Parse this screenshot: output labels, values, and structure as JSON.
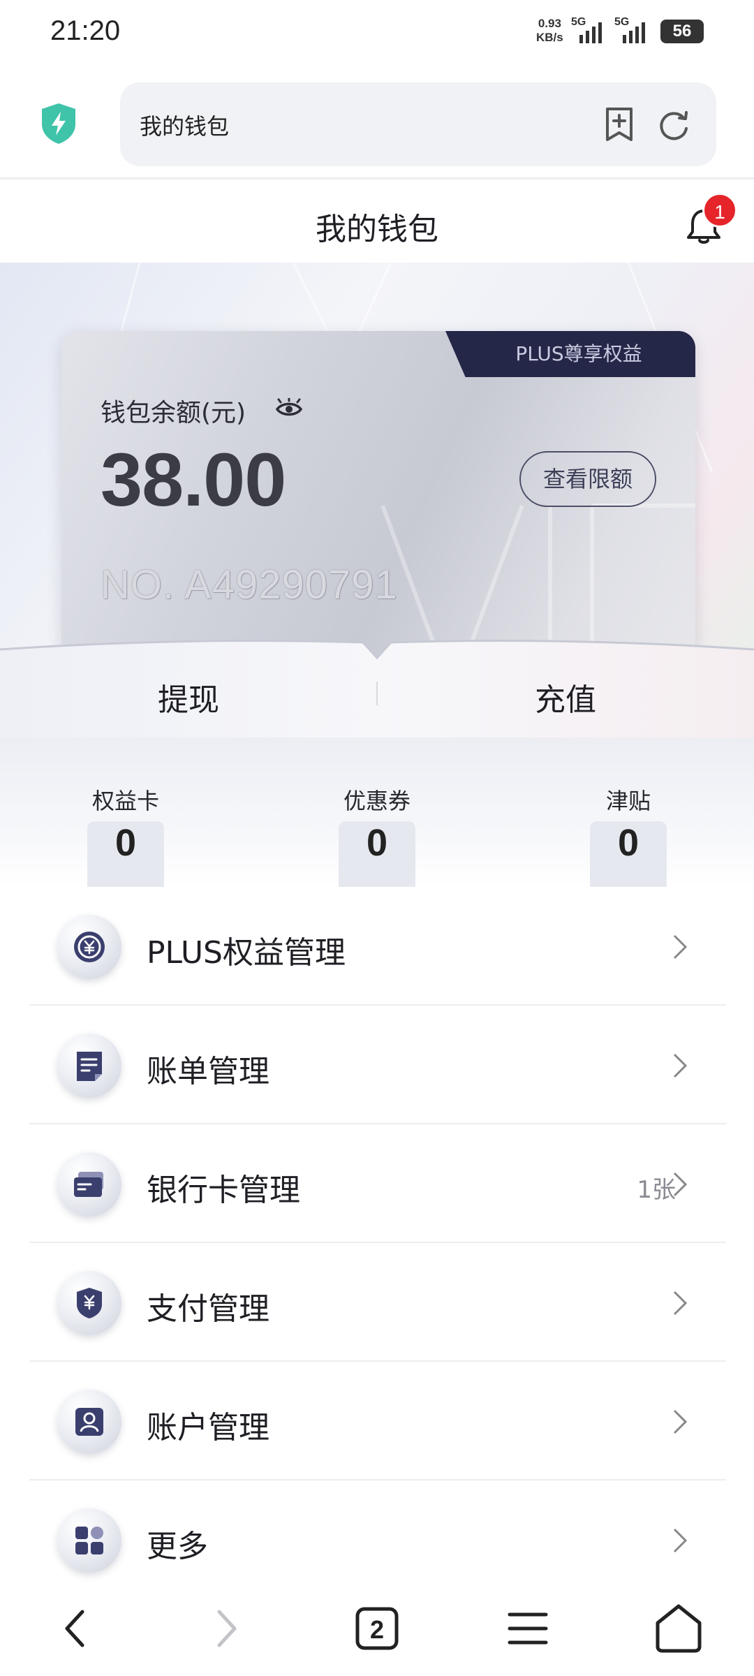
{
  "status_bar": {
    "time": "21:20",
    "net_speed_value": "0.93",
    "net_speed_unit": "KB/s",
    "signal1_label": "5G",
    "signal2_label": "5G",
    "battery": "56"
  },
  "browser": {
    "address_text": "我的钱包",
    "icons": [
      "shield-bolt-icon",
      "bookmark-add-icon",
      "refresh-icon"
    ]
  },
  "header": {
    "title": "我的钱包",
    "notification_count": "1"
  },
  "wallet_card": {
    "plus_tab": "PLUS尊享权益",
    "balance_label": "钱包余额(元)",
    "balance": "38.00",
    "limit_button": "查看限额",
    "card_number": "NO. A49290791"
  },
  "actions": {
    "withdraw": "提现",
    "recharge": "充值"
  },
  "stats": [
    {
      "label": "权益卡",
      "value": "0"
    },
    {
      "label": "优惠券",
      "value": "0"
    },
    {
      "label": "津贴",
      "value": "0"
    }
  ],
  "menu": [
    {
      "label": "PLUS权益管理",
      "extra": "",
      "icon": "plus-yuan-icon"
    },
    {
      "label": "账单管理",
      "extra": "",
      "icon": "bill-icon"
    },
    {
      "label": "银行卡管理",
      "extra": "1张",
      "icon": "bank-card-icon"
    },
    {
      "label": "支付管理",
      "extra": "",
      "icon": "payment-shield-icon"
    },
    {
      "label": "账户管理",
      "extra": "",
      "icon": "account-icon"
    },
    {
      "label": "更多",
      "extra": "",
      "icon": "grid-icon"
    }
  ],
  "bottom_nav": {
    "tab_count": "2",
    "icons": [
      "back-icon",
      "forward-icon",
      "tabs-icon",
      "menu-icon",
      "home-icon"
    ]
  },
  "colors": {
    "card_dark": "#252748",
    "badge_red": "#e5252a",
    "shield_green": "#3fc3a9",
    "icon_navy": "#3b3f6e"
  }
}
